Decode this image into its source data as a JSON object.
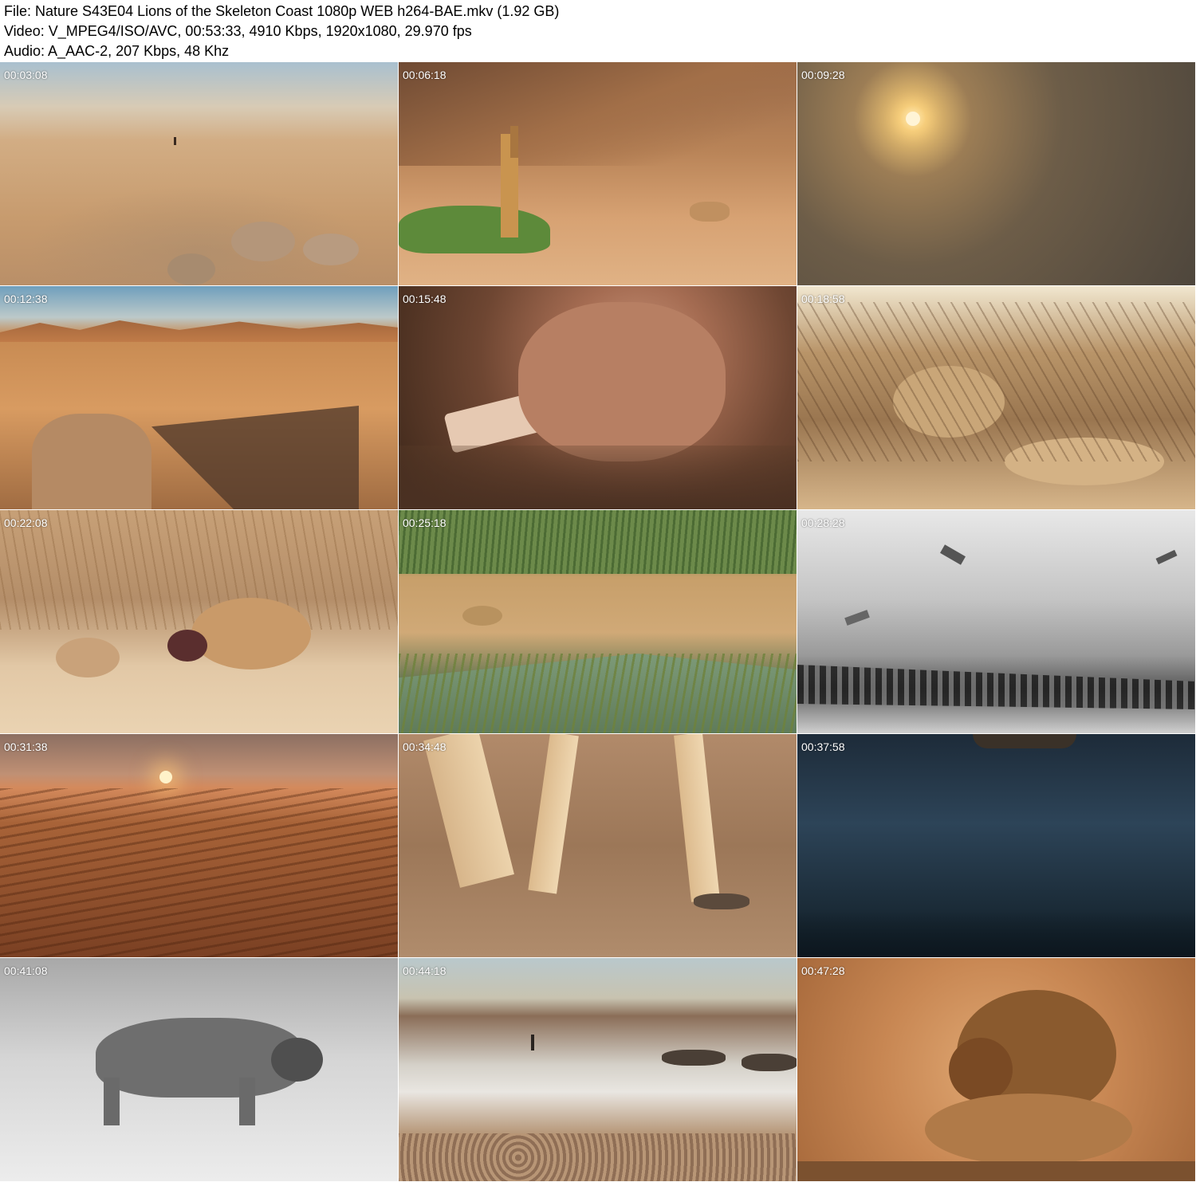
{
  "header": {
    "file_line": "File: Nature S43E04 Lions of the Skeleton Coast 1080p WEB h264-BAE.mkv (1.92 GB)",
    "video_line": "Video: V_MPEG4/ISO/AVC, 00:53:33, 4910 Kbps, 1920x1080, 29.970 fps",
    "audio_line": "Audio: A_AAC-2, 207 Kbps, 48 Khz"
  },
  "thumbnails": [
    {
      "timestamp": "00:03:08"
    },
    {
      "timestamp": "00:06:18"
    },
    {
      "timestamp": "00:09:28"
    },
    {
      "timestamp": "00:12:38"
    },
    {
      "timestamp": "00:15:48"
    },
    {
      "timestamp": "00:18:58"
    },
    {
      "timestamp": "00:22:08"
    },
    {
      "timestamp": "00:25:18"
    },
    {
      "timestamp": "00:28:28"
    },
    {
      "timestamp": "00:31:38"
    },
    {
      "timestamp": "00:34:48"
    },
    {
      "timestamp": "00:37:58"
    },
    {
      "timestamp": "00:41:08"
    },
    {
      "timestamp": "00:44:18"
    },
    {
      "timestamp": "00:47:28"
    }
  ]
}
